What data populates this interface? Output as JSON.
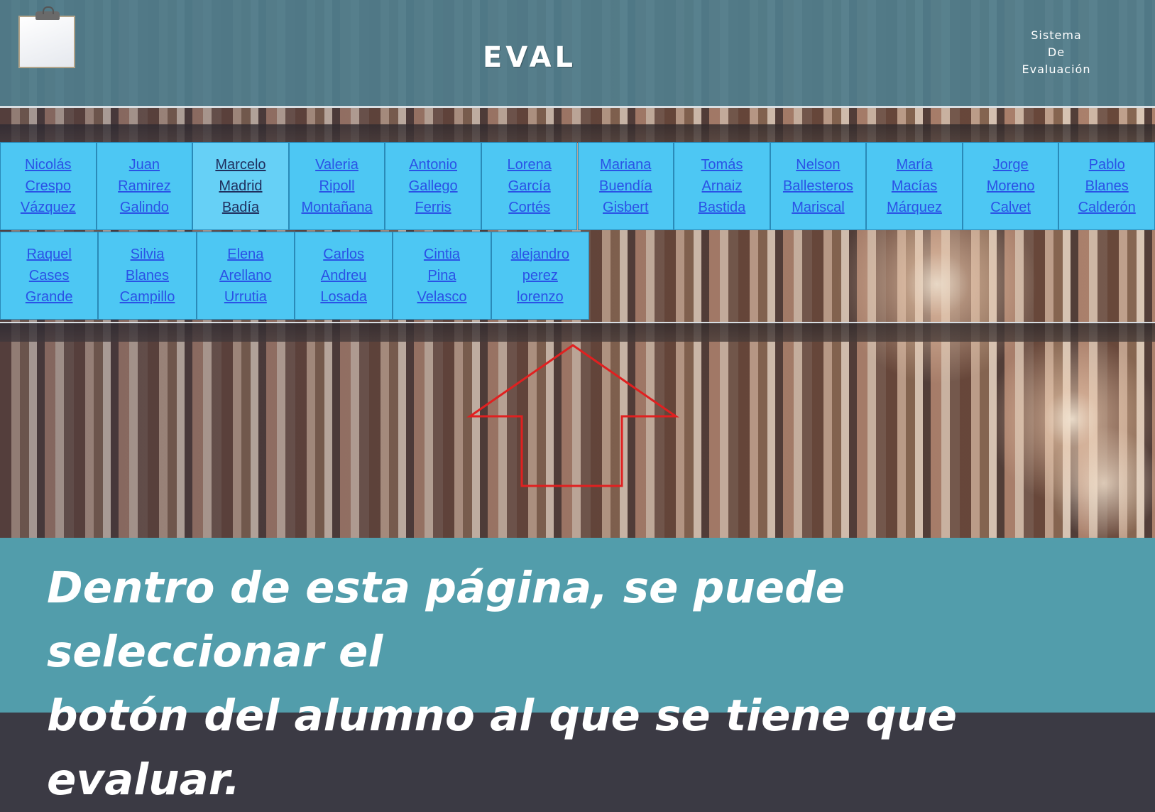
{
  "header": {
    "title": "EVAL",
    "subtitle_lines": [
      "Sistema",
      "De",
      "Evaluación"
    ]
  },
  "students": [
    {
      "lines": [
        "Nicolás",
        "Crespo",
        "Vázquez"
      ]
    },
    {
      "lines": [
        "Juan",
        "Ramirez",
        "Galindo"
      ]
    },
    {
      "lines": [
        "Marcelo",
        "Madrid",
        "Badía"
      ]
    },
    {
      "lines": [
        "Valeria",
        "Ripoll",
        "Montañana"
      ]
    },
    {
      "lines": [
        "Antonio",
        "Gallego",
        "Ferris"
      ]
    },
    {
      "lines": [
        "Lorena",
        "García",
        "Cortés"
      ]
    },
    {
      "lines": [
        "Mariana",
        "Buendía",
        "Gisbert"
      ]
    },
    {
      "lines": [
        "Tomás",
        "Arnaiz",
        "Bastida"
      ]
    },
    {
      "lines": [
        "Nelson",
        "Ballesteros",
        "Mariscal"
      ]
    },
    {
      "lines": [
        "María",
        "Macías",
        "Márquez"
      ]
    },
    {
      "lines": [
        "Jorge",
        "Moreno",
        "Calvet"
      ]
    },
    {
      "lines": [
        "Pablo",
        "Blanes",
        "Calderón"
      ]
    },
    {
      "lines": [
        "Raquel",
        "Cases",
        "Grande"
      ]
    },
    {
      "lines": [
        "Silvia",
        "Blanes",
        "Campillo"
      ]
    },
    {
      "lines": [
        "Elena",
        "Arellano",
        "Urrutia"
      ]
    },
    {
      "lines": [
        "Carlos",
        "Andreu",
        "Losada"
      ]
    },
    {
      "lines": [
        "Cintia",
        "Pina",
        "Velasco"
      ]
    },
    {
      "lines": [
        "alejandro",
        "perez",
        "lorenzo"
      ]
    }
  ],
  "caption": {
    "lines": [
      "Dentro de esta página, se puede seleccionar el",
      "botón del alumno al que se tiene que evaluar."
    ]
  },
  "colors": {
    "header_bg": "#507d8c",
    "cell_bg": "#4dc7f3",
    "link": "#2a52e6",
    "arrow": "#e02020",
    "caption_bg": "#529dab"
  }
}
